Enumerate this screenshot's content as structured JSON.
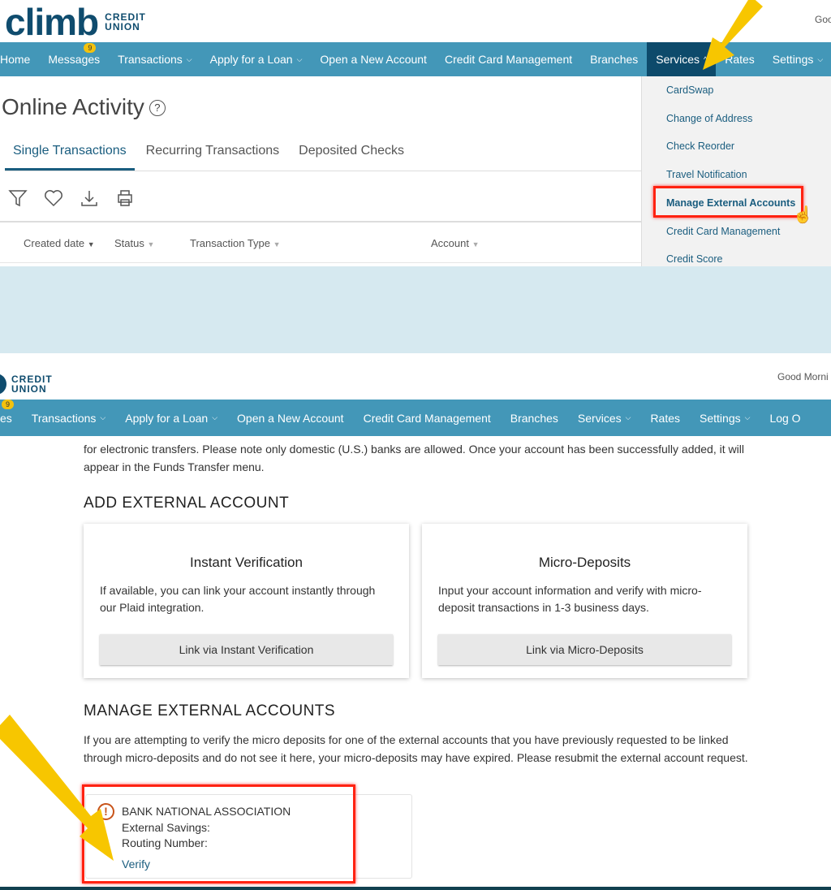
{
  "top": {
    "logo": {
      "word": "climb",
      "sub1": "CREDIT",
      "sub2": "UNION"
    },
    "greeting": "Goo",
    "nav": [
      {
        "label": "Home"
      },
      {
        "label": "Messages",
        "badge": "9"
      },
      {
        "label": "Transactions",
        "chev": "⌵"
      },
      {
        "label": "Apply for a Loan",
        "chev": "⌵"
      },
      {
        "label": "Open a New Account"
      },
      {
        "label": "Credit Card Management"
      },
      {
        "label": "Branches"
      },
      {
        "label": "Services",
        "chev": "^",
        "active": true
      },
      {
        "label": "Rates"
      },
      {
        "label": "Settings",
        "chev": "⌵"
      }
    ],
    "page_title": "Online Activity",
    "help_icon": "?",
    "tabs": [
      "Single Transactions",
      "Recurring Transactions",
      "Deposited Checks"
    ],
    "columns": [
      "Created date",
      "Status",
      "Transaction Type",
      "Account"
    ],
    "services_menu": [
      "CardSwap",
      "Change of Address",
      "Check Reorder",
      "Travel Notification",
      "Manage External Accounts",
      "Credit Card Management",
      "Credit Score"
    ]
  },
  "bottom": {
    "logo": {
      "sub1": "CREDIT",
      "sub2": "UNION"
    },
    "greeting": "Good Morni",
    "messages_badge": "9",
    "nav": [
      "es",
      "Transactions",
      "Apply for a Loan",
      "Open a New Account",
      "Credit Card Management",
      "Branches",
      "Services",
      "Rates",
      "Settings",
      "Log O"
    ],
    "intro": "for electronic transfers. Please note only domestic (U.S.) banks are allowed. Once your account has been successfully added, it will appear in the Funds Transfer menu.",
    "add_heading": "ADD EXTERNAL ACCOUNT",
    "cards": [
      {
        "title": "Instant Verification",
        "text": "If available, you can link your account instantly through our Plaid integration.",
        "button": "Link via Instant Verification"
      },
      {
        "title": "Micro-Deposits",
        "text": "Input your account information and verify with micro-deposit transactions in 1-3 business days.",
        "button": "Link via Micro-Deposits"
      }
    ],
    "manage_heading": "MANAGE EXTERNAL ACCOUNTS",
    "manage_text": "If you are attempting to verify the micro deposits for one of the external accounts that you have previously requested to be linked through micro-deposits and do not see it here, your micro-deposits may have expired. Please resubmit the external account request.",
    "account": {
      "bank": "BANK NATIONAL ASSOCIATION",
      "type": "External Savings:",
      "routing": "Routing Number:",
      "verify": "Verify",
      "status_icon": "!"
    }
  },
  "colors": {
    "nav": "#4397b8",
    "nav_active": "#0d4a6b",
    "highlight": "#ff2211",
    "arrow": "#f7c600",
    "link": "#1a5d7f"
  }
}
